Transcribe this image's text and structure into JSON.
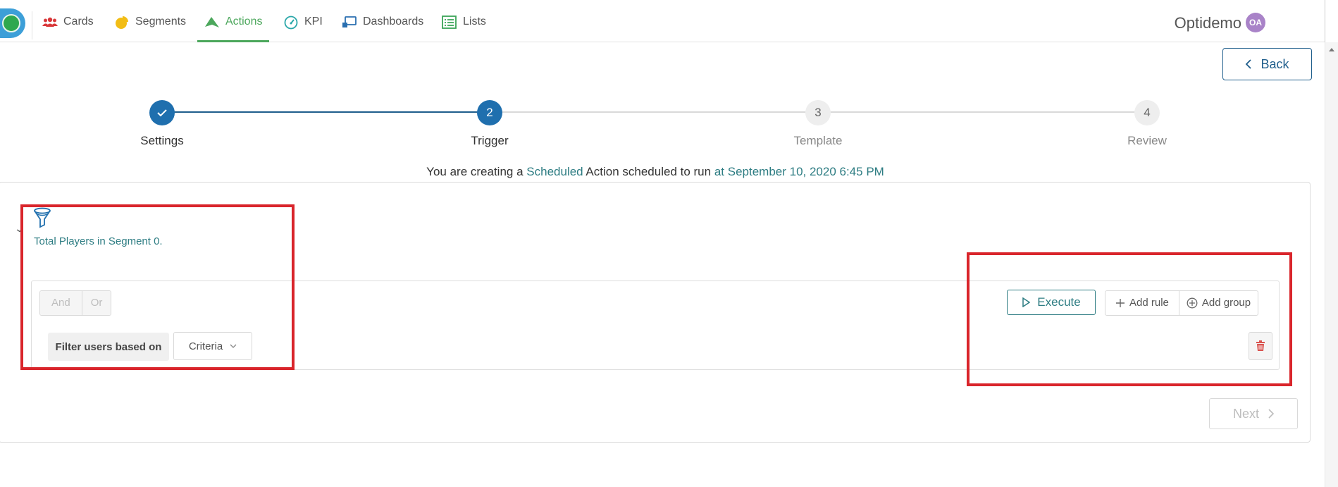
{
  "nav": {
    "items": [
      {
        "label": "Cards",
        "icon": "users-icon",
        "active": false
      },
      {
        "label": "Segments",
        "icon": "pie-chart-icon",
        "active": false
      },
      {
        "label": "Actions",
        "icon": "paper-plane-icon",
        "active": true
      },
      {
        "label": "KPI",
        "icon": "gauge-icon",
        "active": false
      },
      {
        "label": "Dashboards",
        "icon": "dashboard-icon",
        "active": false
      },
      {
        "label": "Lists",
        "icon": "list-icon",
        "active": false
      }
    ],
    "brand": "Optidemo",
    "avatar_initials": "OA"
  },
  "back_button": {
    "label": "Back"
  },
  "stepper": {
    "steps": [
      {
        "number": "1",
        "label": "Settings",
        "state": "done"
      },
      {
        "number": "2",
        "label": "Trigger",
        "state": "active"
      },
      {
        "number": "3",
        "label": "Template",
        "state": "pending"
      },
      {
        "number": "4",
        "label": "Review",
        "state": "pending"
      }
    ]
  },
  "info": {
    "prefix": "You are creating a",
    "action_type": "Scheduled",
    "middle": "Action scheduled to run",
    "schedule": "at September 10, 2020 6:45 PM"
  },
  "segment": {
    "text": "Total Players in Segment 0."
  },
  "rule_builder": {
    "and_label": "And",
    "or_label": "Or",
    "filter_label": "Filter users based on",
    "criteria_label": "Criteria",
    "execute_label": "Execute",
    "add_rule_label": "Add rule",
    "add_group_label": "Add group"
  },
  "next_button": {
    "label": "Next"
  },
  "colors": {
    "accent_green": "#4ca75c",
    "teal": "#2e7d83",
    "step_blue": "#1f6fae",
    "annotation_red": "#d9252b"
  }
}
